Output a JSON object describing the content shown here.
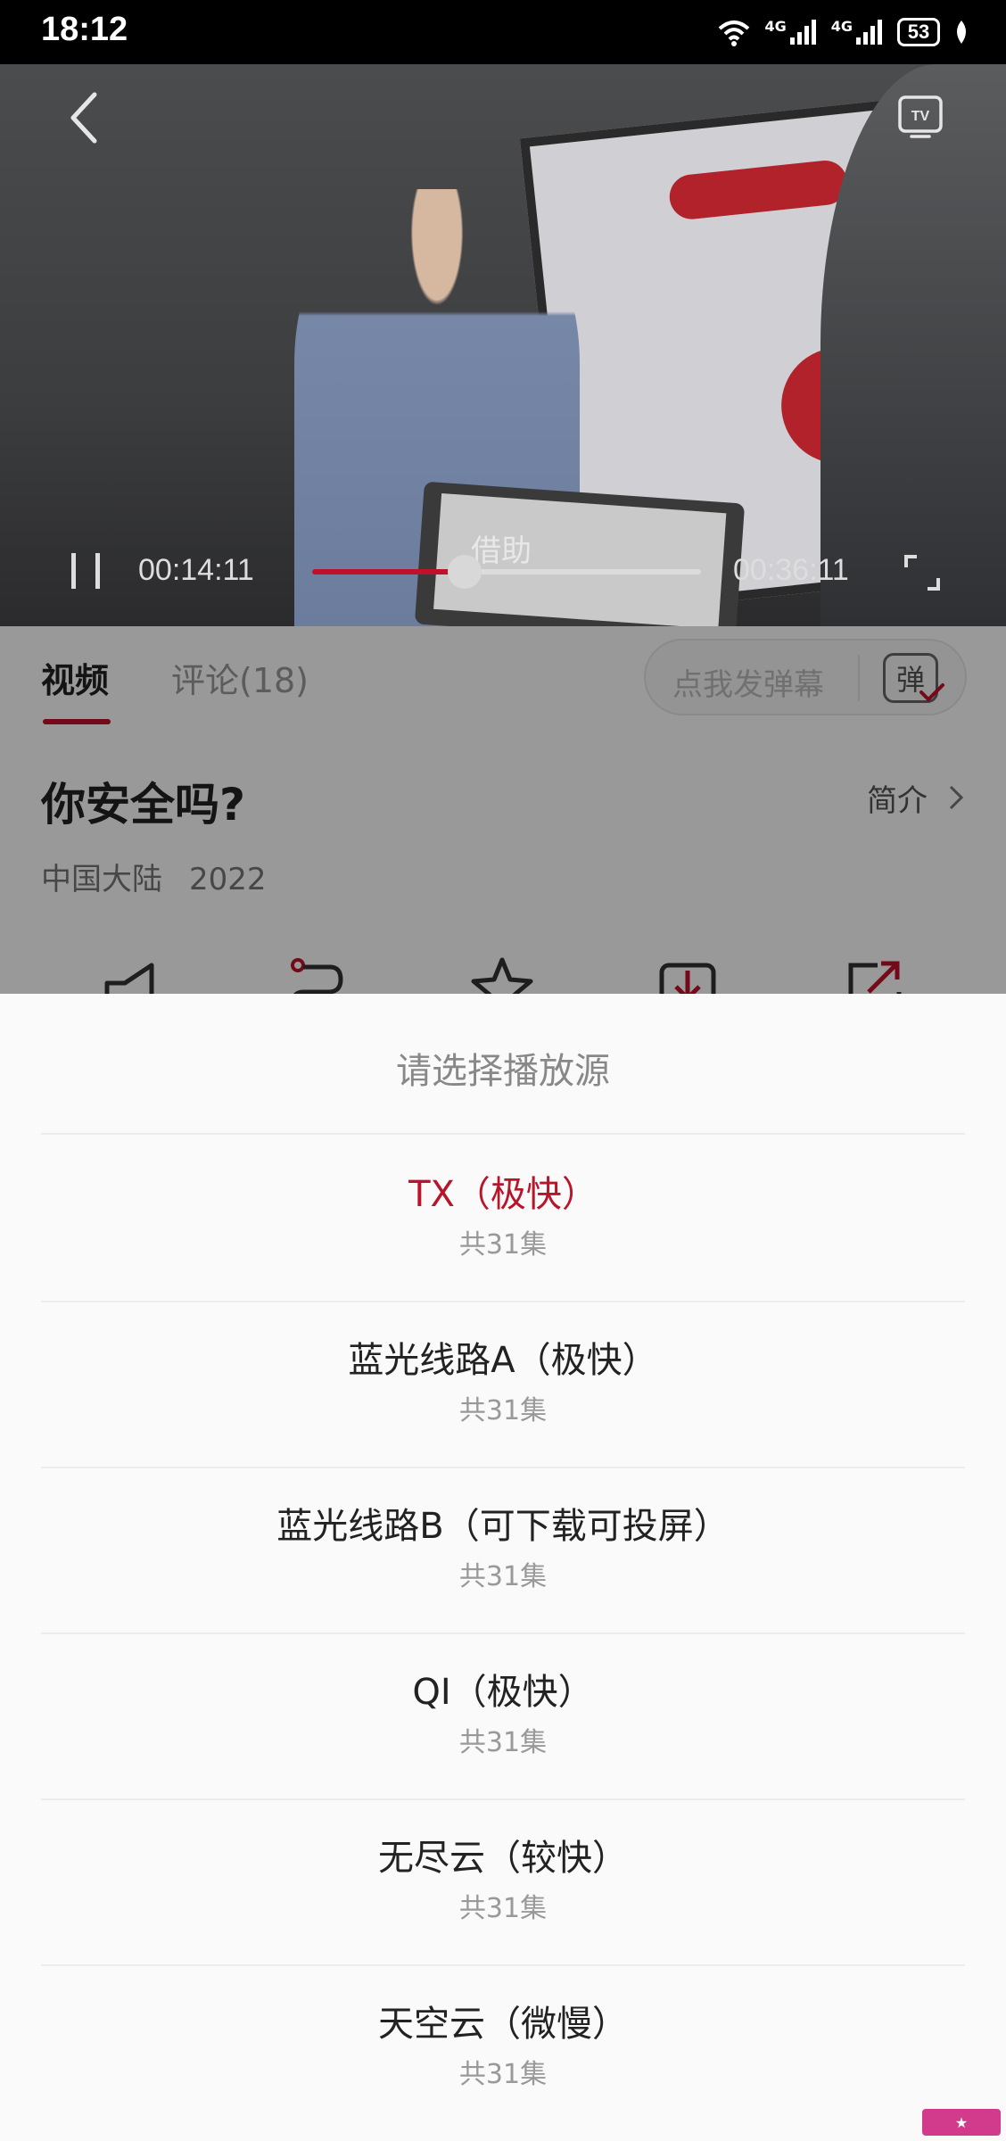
{
  "status_bar": {
    "time": "18:12",
    "network_1": "4G",
    "network_2": "4G",
    "battery": "53",
    "icons": [
      "wifi-icon",
      "signal-icon",
      "signal-icon",
      "battery-icon",
      "leaf-icon"
    ]
  },
  "player": {
    "current_time": "00:14:11",
    "total_time": "00:36:11",
    "progress": 0.392,
    "subtitle": "借助",
    "icons": [
      "back-icon",
      "tv-cast-icon",
      "pause-icon",
      "fullscreen-icon"
    ]
  },
  "tabs": [
    {
      "label": "视频",
      "active": true
    },
    {
      "label": "评论(18)",
      "active": false
    }
  ],
  "danmaku": {
    "placeholder": "点我发弹幕",
    "toggle_label": "弹"
  },
  "show": {
    "title": "你安全吗?",
    "intro_label": "简介",
    "region": "中国大陆",
    "year": "2022"
  },
  "actions": [
    "megaphone-icon",
    "route-icon",
    "star-icon",
    "download-icon",
    "share-icon"
  ],
  "sheet": {
    "title": "请选择播放源",
    "sources": [
      {
        "name": "TX（极快）",
        "count": "共31集",
        "active": true
      },
      {
        "name": "蓝光线路A（极快）",
        "count": "共31集",
        "active": false
      },
      {
        "name": "蓝光线路B（可下载可投屏）",
        "count": "共31集",
        "active": false
      },
      {
        "name": "QI（极快）",
        "count": "共31集",
        "active": false
      },
      {
        "name": "无尽云（较快）",
        "count": "共31集",
        "active": false
      },
      {
        "name": "天空云（微慢）",
        "count": "共31集",
        "active": false
      }
    ]
  },
  "colors": {
    "accent": "#c0102a",
    "sheet_bg": "#fafafa"
  }
}
